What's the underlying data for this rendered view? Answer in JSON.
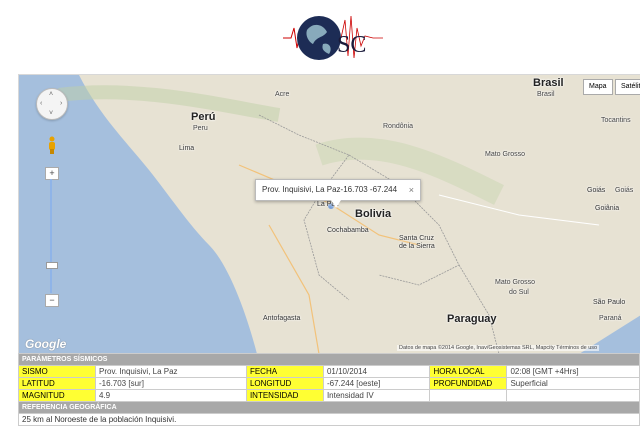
{
  "logo": {
    "text": "SC"
  },
  "map": {
    "nav_arrows": {
      "up": "˄",
      "down": "˅",
      "left": "‹",
      "right": "›"
    },
    "zoom": {
      "plus": "+",
      "minus": "−",
      "level": 0.36
    },
    "type_buttons": [
      "Mapa",
      "Satélite"
    ],
    "countries": {
      "peru": "Perú",
      "bolivia": "Bolivia",
      "brasil": "Brasil",
      "paraguay": "Paraguay"
    },
    "labels": {
      "acre": "Acre",
      "peru_region": "Peru",
      "lima": "Lima",
      "rondonia": "Rondônia",
      "mato_grosso": "Mato Grosso",
      "tocantins": "Tocantins",
      "brasil_region": "Brasil",
      "goias_city": "Goiás",
      "goias_region": "Goiás",
      "goiania": "Goiânia",
      "la_paz": "La Paz",
      "cochabamba": "Cochabamba",
      "santa_cruz_1": "Santa Cruz",
      "santa_cruz_2": "de la Sierra",
      "mgs_1": "Mato Grosso",
      "mgs_2": "do Sul",
      "antofagasta": "Antofagasta",
      "sao_paulo": "São Paulo",
      "parana": "Paraná"
    },
    "infowindow": {
      "text": "Prov. Inquisivi, La Paz-16.703 -67.244",
      "close": "×"
    },
    "google": "Google",
    "attribution": "Datos de mapa ©2014 Google, Inav/Geosistemas SRL, Mapcity   Términos de uso"
  },
  "params": {
    "header": "PARÁMETROS SÍSMICOS",
    "rows": [
      [
        {
          "k": "SISMO",
          "v": "Prov. Inquisivi, La Paz"
        },
        {
          "k": "FECHA",
          "v": "01/10/2014"
        },
        {
          "k": "HORA LOCAL",
          "v": "02:08 [GMT +4Hrs]"
        }
      ],
      [
        {
          "k": "LATITUD",
          "v": "-16.703 [sur]"
        },
        {
          "k": "LONGITUD",
          "v": "-67.244 [oeste]"
        },
        {
          "k": "PROFUNDIDAD",
          "v": "Superficial"
        }
      ],
      [
        {
          "k": "MAGNITUD",
          "v": "4.9"
        },
        {
          "k": "INTENSIDAD",
          "v": "Intensidad IV"
        },
        {
          "k": "",
          "v": ""
        }
      ]
    ],
    "ref_header": "REFERENCIA GEOGRÁFICA",
    "ref_text": "25 km al Noroeste de la población Inquisivi."
  },
  "colors": {
    "key_bg": "#ffff33",
    "header_bg": "#a8a8a8",
    "ocean": "#a5bfdd",
    "land": "#e7e2d3"
  }
}
